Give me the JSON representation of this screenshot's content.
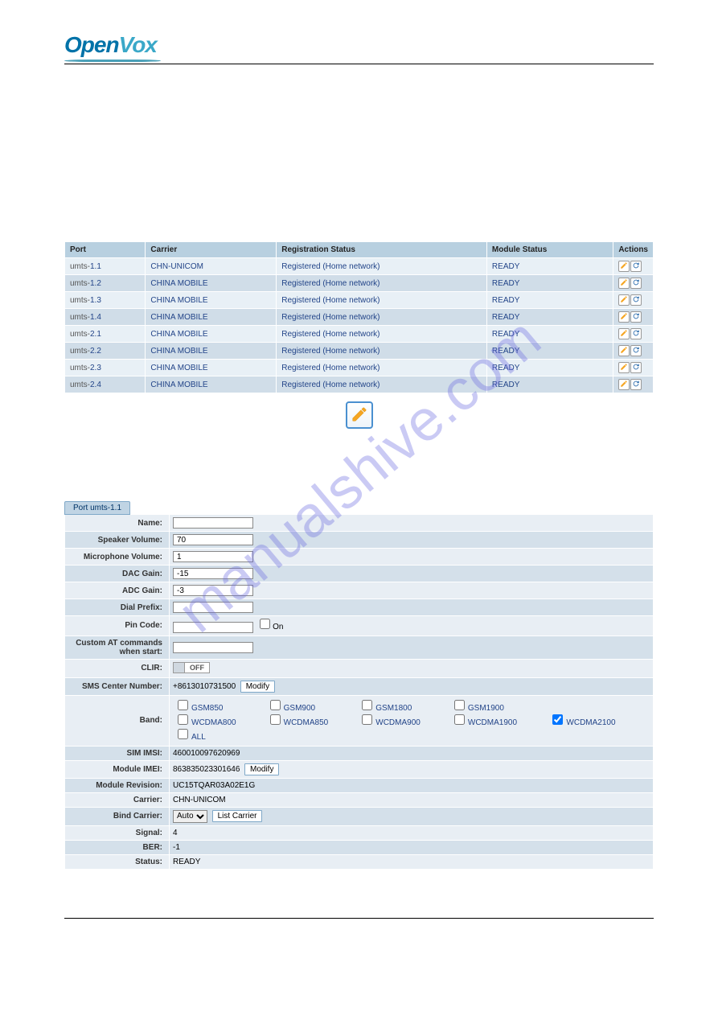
{
  "logo": {
    "open": "Open",
    "vox": "Vox"
  },
  "watermark": "manualshive.com",
  "ports_table": {
    "headers": {
      "port": "Port",
      "carrier": "Carrier",
      "reg": "Registration Status",
      "mod": "Module Status",
      "actions": "Actions"
    },
    "rows": [
      {
        "prefix": "umts-",
        "suffix": "1.1",
        "carrier": "CHN-UNICOM",
        "reg": "Registered (Home network)",
        "mod": "READY"
      },
      {
        "prefix": "umts-",
        "suffix": "1.2",
        "carrier": "CHINA MOBILE",
        "reg": "Registered (Home network)",
        "mod": "READY"
      },
      {
        "prefix": "umts-",
        "suffix": "1.3",
        "carrier": "CHINA MOBILE",
        "reg": "Registered (Home network)",
        "mod": "READY"
      },
      {
        "prefix": "umts-",
        "suffix": "1.4",
        "carrier": "CHINA MOBILE",
        "reg": "Registered (Home network)",
        "mod": "READY"
      },
      {
        "prefix": "umts-",
        "suffix": "2.1",
        "carrier": "CHINA MOBILE",
        "reg": "Registered (Home network)",
        "mod": "READY"
      },
      {
        "prefix": "umts-",
        "suffix": "2.2",
        "carrier": "CHINA MOBILE",
        "reg": "Registered (Home network)",
        "mod": "READY"
      },
      {
        "prefix": "umts-",
        "suffix": "2.3",
        "carrier": "CHINA MOBILE",
        "reg": "Registered (Home network)",
        "mod": "READY"
      },
      {
        "prefix": "umts-",
        "suffix": "2.4",
        "carrier": "CHINA MOBILE",
        "reg": "Registered (Home network)",
        "mod": "READY"
      }
    ]
  },
  "port_tab": "Port umts-1.1",
  "form": {
    "name": {
      "label": "Name:",
      "value": ""
    },
    "speaker": {
      "label": "Speaker Volume:",
      "value": "70"
    },
    "mic": {
      "label": "Microphone Volume:",
      "value": "1"
    },
    "dac": {
      "label": "DAC Gain:",
      "value": "-15"
    },
    "adc": {
      "label": "ADC Gain:",
      "value": "-3"
    },
    "dial_prefix": {
      "label": "Dial Prefix:",
      "value": ""
    },
    "pin": {
      "label": "Pin Code:",
      "value": "",
      "on_label": "On"
    },
    "at": {
      "label": "Custom AT commands when start:",
      "value": ""
    },
    "clir": {
      "label": "CLIR:",
      "value": "OFF"
    },
    "sms_center": {
      "label": "SMS Center Number:",
      "value": "+8613010731500",
      "modify": "Modify"
    },
    "band": {
      "label": "Band:"
    },
    "imsi": {
      "label": "SIM IMSI:",
      "value": "460010097620969"
    },
    "imei": {
      "label": "Module IMEI:",
      "value": "863835023301646",
      "modify": "Modify"
    },
    "revision": {
      "label": "Module Revision:",
      "value": "UC15TQAR03A02E1G"
    },
    "carrier": {
      "label": "Carrier:",
      "value": "CHN-UNICOM"
    },
    "bind_carrier": {
      "label": "Bind Carrier:",
      "value": "Auto",
      "list": "List Carrier"
    },
    "signal": {
      "label": "Signal:",
      "value": "4"
    },
    "ber": {
      "label": "BER:",
      "value": "-1"
    },
    "status": {
      "label": "Status:",
      "value": "READY"
    }
  },
  "bands": {
    "gsm850": "GSM850",
    "gsm900": "GSM900",
    "gsm1800": "GSM1800",
    "gsm1900": "GSM1900",
    "wcdma800": "WCDMA800",
    "wcdma850": "WCDMA850",
    "wcdma900": "WCDMA900",
    "wcdma1900": "WCDMA1900",
    "wcdma2100": "WCDMA2100",
    "all": "ALL"
  }
}
